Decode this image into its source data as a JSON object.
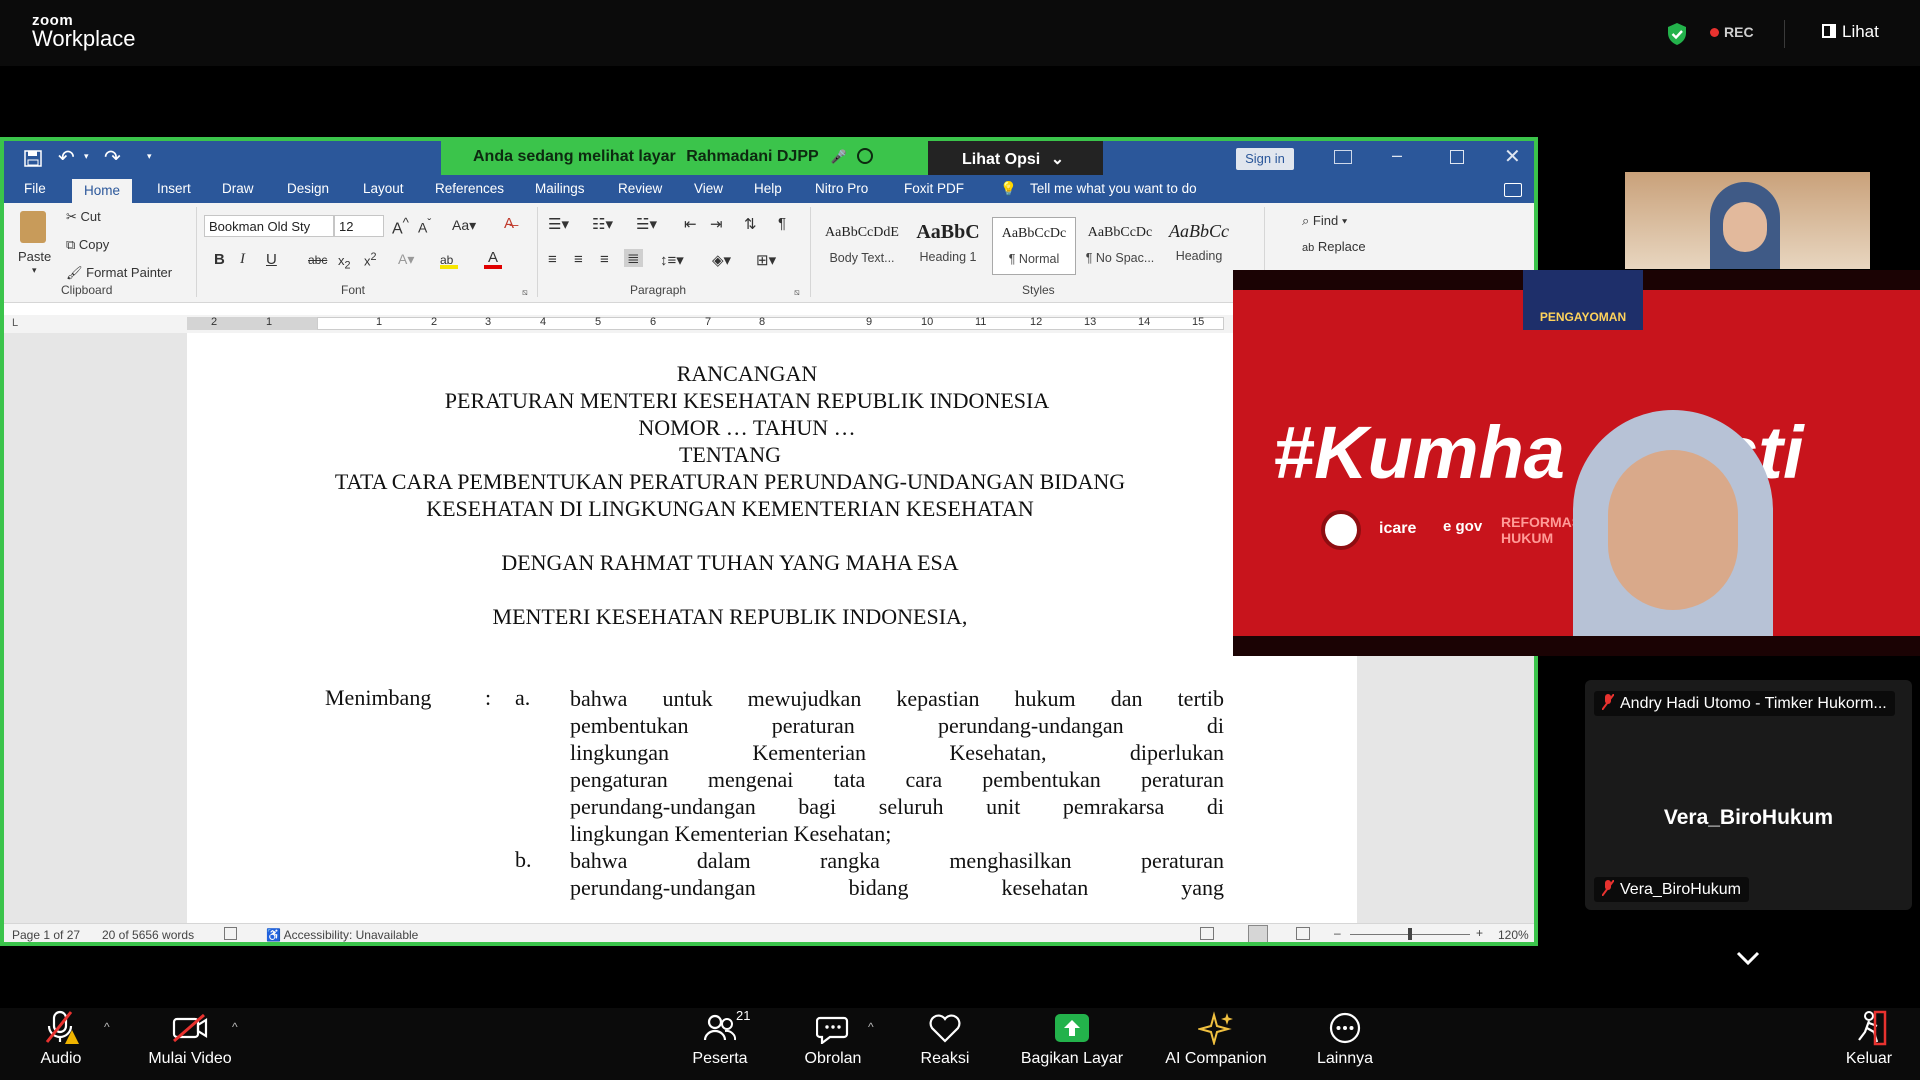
{
  "zoom": {
    "brand_small": "zoom",
    "brand_big": "Workplace",
    "rec_label": "REC",
    "view_label": "Lihat"
  },
  "share_banner": {
    "prefix": "Anda sedang melihat layar",
    "presenter": "Rahmadani DJPP",
    "options_label": "Lihat Opsi"
  },
  "word": {
    "signin": "Sign in",
    "tabs": [
      "File",
      "Home",
      "Insert",
      "Draw",
      "Design",
      "Layout",
      "References",
      "Mailings",
      "Review",
      "View",
      "Help",
      "Nitro Pro",
      "Foxit PDF"
    ],
    "tell_me": "Tell me what you want to do",
    "clipboard": {
      "paste": "Paste",
      "cut": "Cut",
      "copy": "Copy",
      "format_painter": "Format Painter",
      "group": "Clipboard"
    },
    "font": {
      "name": "Bookman Old Sty",
      "size": "12",
      "group": "Font"
    },
    "paragraph_group": "Paragraph",
    "styles": [
      {
        "preview": "AaBbCcDdE",
        "label": "Body Text..."
      },
      {
        "preview": "AaBbC",
        "label": "Heading 1"
      },
      {
        "preview": "AaBbCcDc",
        "label": "¶ Normal"
      },
      {
        "preview": "AaBbCcDc",
        "label": "¶ No Spac..."
      },
      {
        "preview": "AaBbCc",
        "label": "Heading"
      }
    ],
    "styles_group": "Styles",
    "editing": {
      "find": "Find",
      "replace": "Replace"
    },
    "ruler_marks": [
      "2",
      "1",
      "1",
      "2",
      "3",
      "4",
      "5",
      "6",
      "7",
      "8",
      "9",
      "10",
      "11",
      "12",
      "13",
      "14",
      "15",
      "16"
    ],
    "doc": {
      "line1": "RANCANGAN",
      "line2": "PERATURAN MENTERI KESEHATAN REPUBLIK INDONESIA",
      "line3": "NOMOR … TAHUN …",
      "line4": "TENTANG",
      "line5": "TATA CARA PEMBENTUKAN PERATURAN PERUNDANG-UNDANGAN BIDANG",
      "line6": "KESEHATAN DI LINGKUNGAN KEMENTERIAN KESEHATAN",
      "line7": "DENGAN RAHMAT TUHAN YANG MAHA ESA",
      "line8": "MENTERI KESEHATAN REPUBLIK INDONESIA,",
      "menimbang": "Menimbang",
      "colon": ":",
      "a_marker": "a.",
      "a_lines": [
        "bahwa untuk mewujudkan kepastian hukum dan tertib",
        "pembentukan peraturan perundang-undangan di",
        "lingkungan Kementerian Kesehatan, diperlukan",
        "pengaturan mengenai tata cara pembentukan peraturan",
        "perundang-undangan bagi seluruh unit pemrakarsa di",
        "lingkungan Kementerian Kesehatan;"
      ],
      "b_marker": "b.",
      "b_lines": [
        "bahwa dalam rangka menghasilkan peraturan",
        "perundang-undangan bidang kesehatan yang"
      ]
    },
    "status": {
      "page": "Page 1 of 27",
      "words": "20 of 5656 words",
      "accessibility": "Accessibility: Unavailable",
      "zoom": "120%"
    }
  },
  "participants": {
    "video_overlay": {
      "pengayoman": "PENGAYOMAN",
      "hashtag": "#Kumha   Pasti",
      "icare": "icare",
      "egov": "e gov",
      "reformasi": "REFORMASI HUKUM"
    },
    "tile_top_name": "Andry Hadi Utomo - Timker Hukorm...",
    "tile_center_name": "Vera_BiroHukum",
    "tile_bottom_name": "Vera_BiroHukum"
  },
  "toolbar": {
    "audio": "Audio",
    "video": "Mulai Video",
    "participants": "Peserta",
    "participants_count": "21",
    "chat": "Obrolan",
    "react": "Reaksi",
    "share": "Bagikan Layar",
    "ai": "AI Companion",
    "more": "Lainnya",
    "leave": "Keluar"
  }
}
